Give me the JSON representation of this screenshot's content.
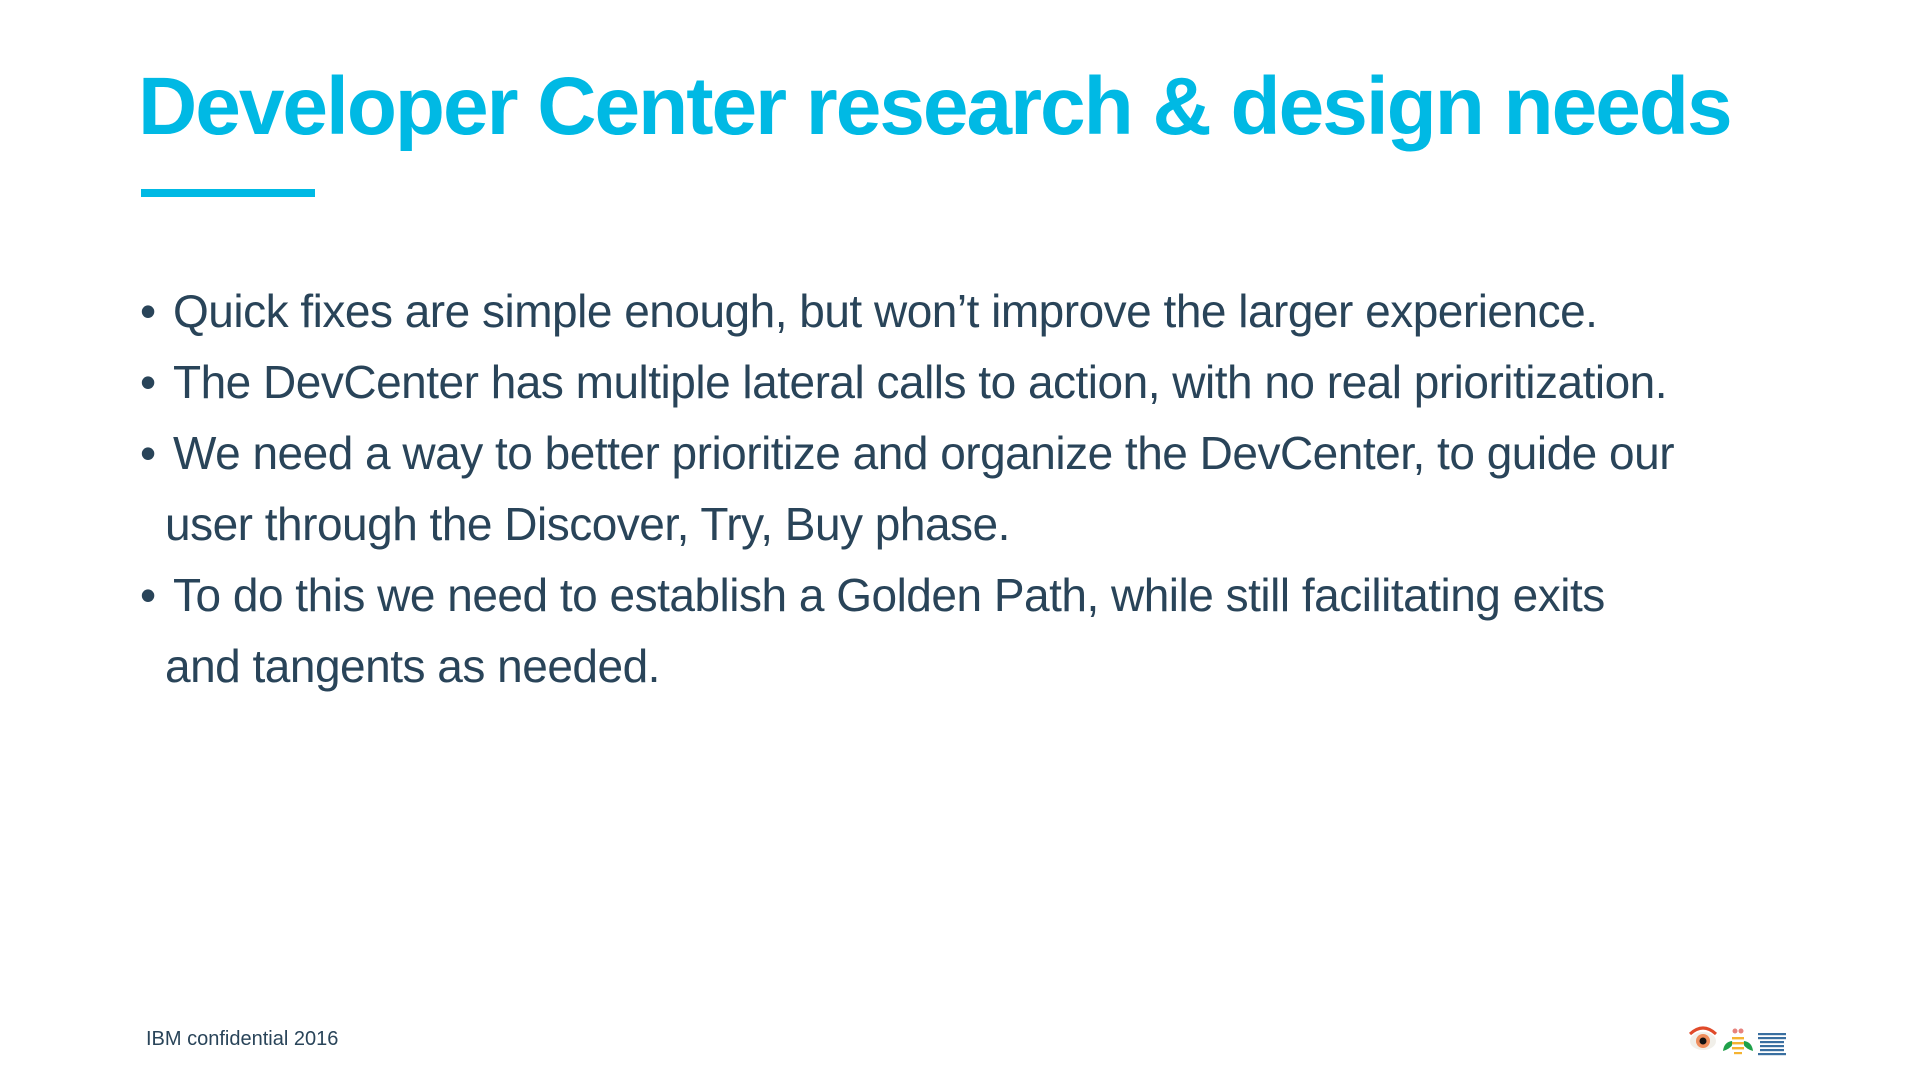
{
  "title": "Developer Center research & design needs",
  "accent_color": "#00b9e4",
  "text_color": "#294459",
  "bullets": [
    {
      "lines": [
        "Quick fixes are simple enough, but won’t improve the larger experience."
      ]
    },
    {
      "lines": [
        "The DevCenter has multiple lateral calls to action, with no real prioritization."
      ]
    },
    {
      "lines": [
        "We need a way to better prioritize and organize the DevCenter, to guide our",
        "user through the Discover, Try, Buy phase."
      ]
    },
    {
      "lines": [
        "To do this we need to establish a Golden Path, while still facilitating exits",
        "and tangents as needed."
      ]
    }
  ],
  "footer": "IBM confidential 2016",
  "logo": "IBM eye-bee-M logo"
}
